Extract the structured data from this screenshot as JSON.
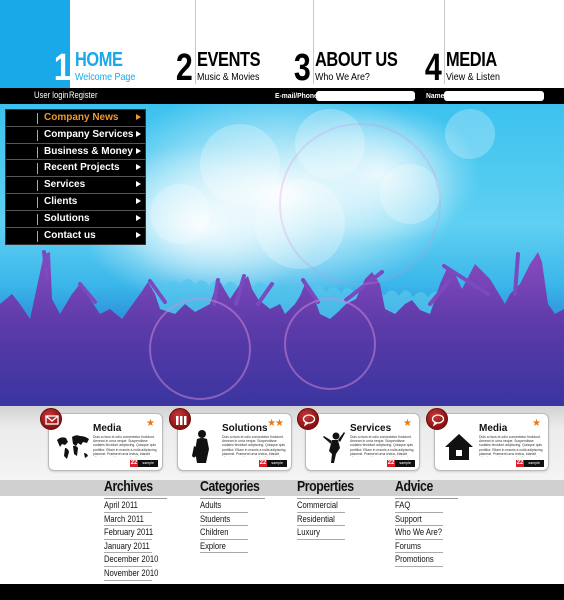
{
  "nav": {
    "items": [
      {
        "num": "1",
        "title": "HOME",
        "subtitle": "Welcome Page",
        "active": true
      },
      {
        "num": "2",
        "title": "EVENTS",
        "subtitle": "Music & Movies",
        "active": false
      },
      {
        "num": "3",
        "title": "ABOUT US",
        "subtitle": "Who We Are?",
        "active": false
      },
      {
        "num": "4",
        "title": "MEDIA",
        "subtitle": "View & Listen",
        "active": false
      }
    ],
    "accent_color": "#1aa9e8"
  },
  "topbar": {
    "user_login": "User login",
    "register": "Register",
    "email_label": "E-mail/Phone",
    "email_value": "",
    "name_label": "Name",
    "name_value": ""
  },
  "sidemenu": {
    "items": [
      {
        "label": "Company News",
        "active": true
      },
      {
        "label": "Company Services",
        "active": false
      },
      {
        "label": "Business & Money",
        "active": false
      },
      {
        "label": "Recent Projects",
        "active": false
      },
      {
        "label": "Services",
        "active": false
      },
      {
        "label": "Clients",
        "active": false
      },
      {
        "label": "Solutions",
        "active": false
      },
      {
        "label": "Contact us",
        "active": false
      }
    ],
    "active_color": "#f0962c"
  },
  "hero": {
    "image": "concert-crowd-silhouettes"
  },
  "cards": [
    {
      "title": "Media",
      "stars": "★",
      "badge_icon": "mail-icon",
      "picture": "world-map",
      "text": "Duis a risus et odio consectetur tincidunt. Aenean in urna neque. Suspendisse sodales tincidunt adipiscing. Quisque quis porttitor. Etiam in mauris a nulla adipiscing placerat. Praesent urna lectus, blandit vitae tempus id, commodo sit amet est.",
      "tag_num": "22",
      "tag_label": "sample"
    },
    {
      "title": "Solutions",
      "stars": "★★",
      "badge_icon": "bars-icon",
      "picture": "saxophone-player",
      "text": "Duis a risus et odio consectetur tincidunt. Aenean in urna neque. Suspendisse sodales tincidunt adipiscing. Quisque quis porttitor. Etiam in mauris a nulla adipiscing placerat. Praesent urna lectus, blandit vitae tempus id, commodo sit amet est.",
      "tag_num": "22",
      "tag_label": "sample"
    },
    {
      "title": "Services",
      "stars": "★",
      "badge_icon": "chat-icon",
      "picture": "jumping-person",
      "text": "Duis a risus et odio consectetur tincidunt. Aenean in urna neque. Suspendisse sodales tincidunt adipiscing. Quisque quis porttitor. Etiam in mauris a nulla adipiscing placerat. Praesent urna lectus, blandit vitae tempus id, commodo sit amet est.",
      "tag_num": "22",
      "tag_label": "sample"
    },
    {
      "title": "Media",
      "stars": "★",
      "badge_icon": "chat-icon",
      "picture": "house",
      "text": "Duis a risus et odio consectetur tincidunt. Aenean in urna neque. Suspendisse sodales tincidunt adipiscing. Quisque quis porttitor. Etiam in mauris a nulla adipiscing placerat. Praesent urna lectus, blandit vitae tempus id, commodo sit amet est.",
      "tag_num": "22",
      "tag_label": "sample"
    }
  ],
  "footer": {
    "columns": [
      {
        "title": "Archives",
        "items": [
          "April 2011",
          "March 2011",
          "February 2011",
          "January 2011",
          "December 2010",
          "November 2010"
        ]
      },
      {
        "title": "Categories",
        "items": [
          "Adults",
          "Students",
          "Children",
          "Explore"
        ]
      },
      {
        "title": "Properties",
        "items": [
          "Commercial",
          "Residential",
          "Luxury"
        ]
      },
      {
        "title": "Advice",
        "items": [
          "FAQ",
          "Support",
          "Who We Are?",
          "Forums",
          "Promotions"
        ]
      }
    ]
  }
}
